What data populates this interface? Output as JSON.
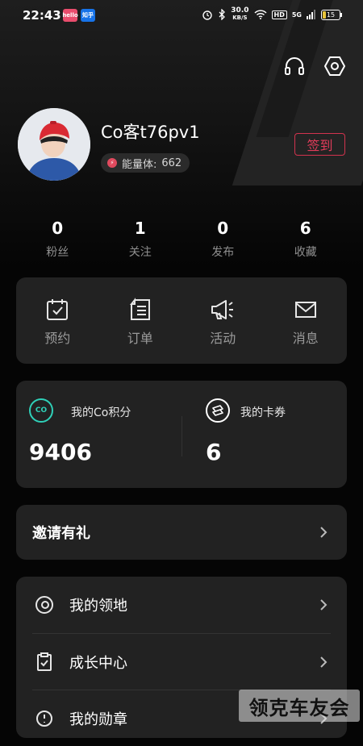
{
  "status_bar": {
    "time": "22:43",
    "app_icon_1": "hello",
    "app_icon_2": "知乎",
    "net_speed_value": "30.0",
    "net_speed_unit": "KB/S",
    "hd_label": "HD",
    "signal_label": "5G",
    "battery": "15"
  },
  "profile": {
    "username": "Co客t76pv1",
    "energy_label": "能量体:",
    "energy_value": "662",
    "checkin_label": "签到"
  },
  "stats": [
    {
      "value": "0",
      "label": "粉丝"
    },
    {
      "value": "1",
      "label": "关注"
    },
    {
      "value": "0",
      "label": "发布"
    },
    {
      "value": "6",
      "label": "收藏"
    }
  ],
  "actions": [
    {
      "label": "预约",
      "icon": "calendar-check-icon"
    },
    {
      "label": "订单",
      "icon": "document-list-icon"
    },
    {
      "label": "活动",
      "icon": "megaphone-icon"
    },
    {
      "label": "消息",
      "icon": "envelope-icon"
    }
  ],
  "points": {
    "co_icon_text": "CO",
    "co_title": "我的Co积分",
    "co_value": "9406",
    "coupon_title": "我的卡券",
    "coupon_value": "6"
  },
  "invite": {
    "label": "邀请有礼"
  },
  "menu": [
    {
      "label": "我的领地",
      "icon": "territory-icon"
    },
    {
      "label": "成长中心",
      "icon": "clipboard-check-icon"
    },
    {
      "label": "我的勋章",
      "icon": "medal-icon"
    }
  ],
  "watermark": "领克车友会",
  "colors": {
    "accent_red": "#e23c5a",
    "accent_teal": "#2fd0b8",
    "card_bg": "#222222",
    "page_bg": "#050505"
  }
}
